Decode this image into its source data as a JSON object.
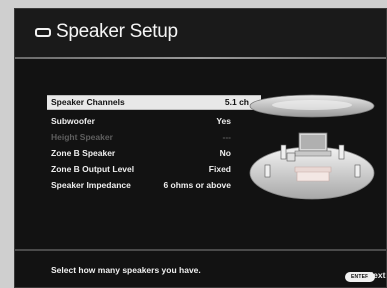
{
  "header": {
    "title": "Speaker Setup",
    "icon": "menu-minus-icon"
  },
  "menu": {
    "rows": [
      {
        "label": "Speaker Channels",
        "value": "5.1 ch"
      },
      {
        "label": "Subwoofer",
        "value": "Yes"
      },
      {
        "label": "Height Speaker",
        "value": "---"
      },
      {
        "label": "Zone B Speaker",
        "value": "No"
      },
      {
        "label": "Zone B Output Level",
        "value": "Fixed"
      },
      {
        "label": "Speaker Impedance",
        "value": "6 ohms or above"
      }
    ],
    "selected_index": 0,
    "disabled_index": 2
  },
  "footer": {
    "hint": "Select how many speakers you have.",
    "enter_key": "ENTER",
    "next_label": "Next"
  },
  "colors": {
    "screen_bg": "#121212",
    "selection_bg": "#e8e8e8",
    "disabled_text": "#5e5e5e",
    "room_floor": "#dcdcdc"
  }
}
